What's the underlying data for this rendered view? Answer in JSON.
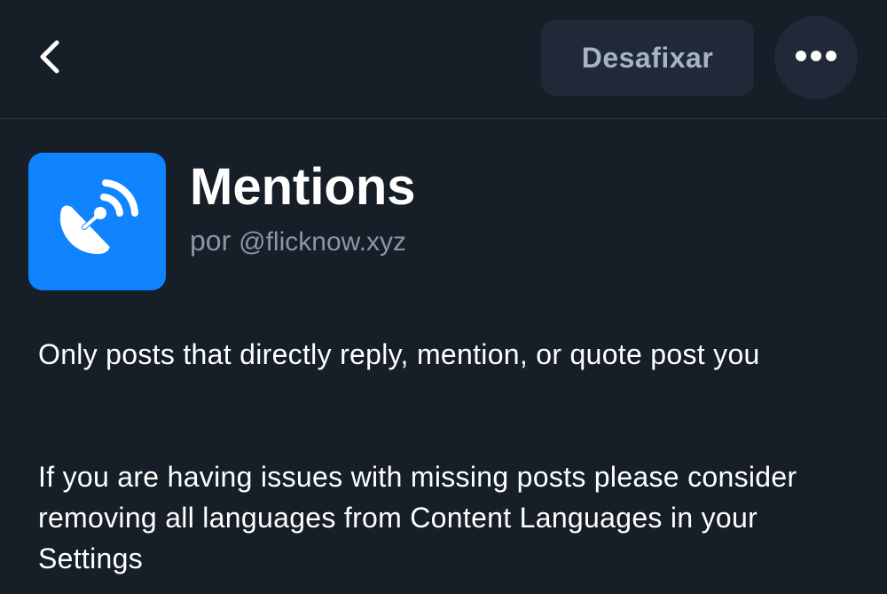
{
  "header": {
    "back_icon": "chevron-left-icon",
    "unpin_label": "Desafixar",
    "more_icon": "ellipsis-horizontal-icon"
  },
  "feed": {
    "avatar_icon": "satellite-dish-icon",
    "avatar_color": "#1083fe",
    "title": "Mentions",
    "by_prefix": "por",
    "creator_handle": "@flicknow.xyz",
    "description_1": "Only posts that directly reply, mention, or quote post you",
    "description_2": "If you are having issues with missing posts please consider removing all languages from Content Languages in your Settings"
  }
}
